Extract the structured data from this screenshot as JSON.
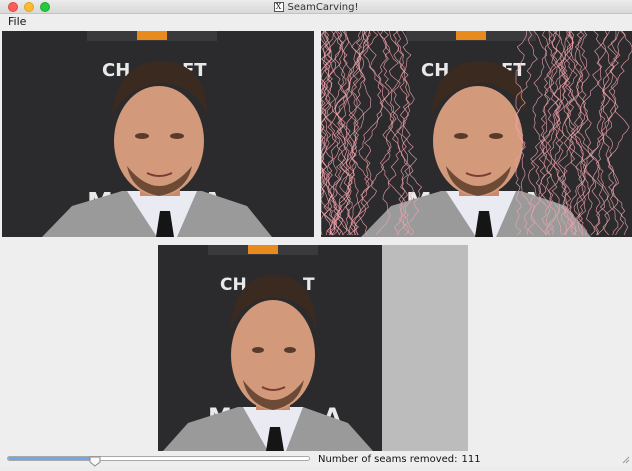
{
  "window": {
    "title": "SeamCarving!",
    "title_icon": "x11-icon"
  },
  "menu": {
    "items": [
      "File"
    ]
  },
  "panels": {
    "original_label": "",
    "seams_label": "",
    "result_label": ""
  },
  "status": {
    "label": "Number of seams removed:",
    "count": "111",
    "slider_fraction": 0.29
  },
  "colors": {
    "seam_lines": "#f2a3ad",
    "slider_fill": "#6fa8e8",
    "removed_area": "#bcbcbc"
  }
}
